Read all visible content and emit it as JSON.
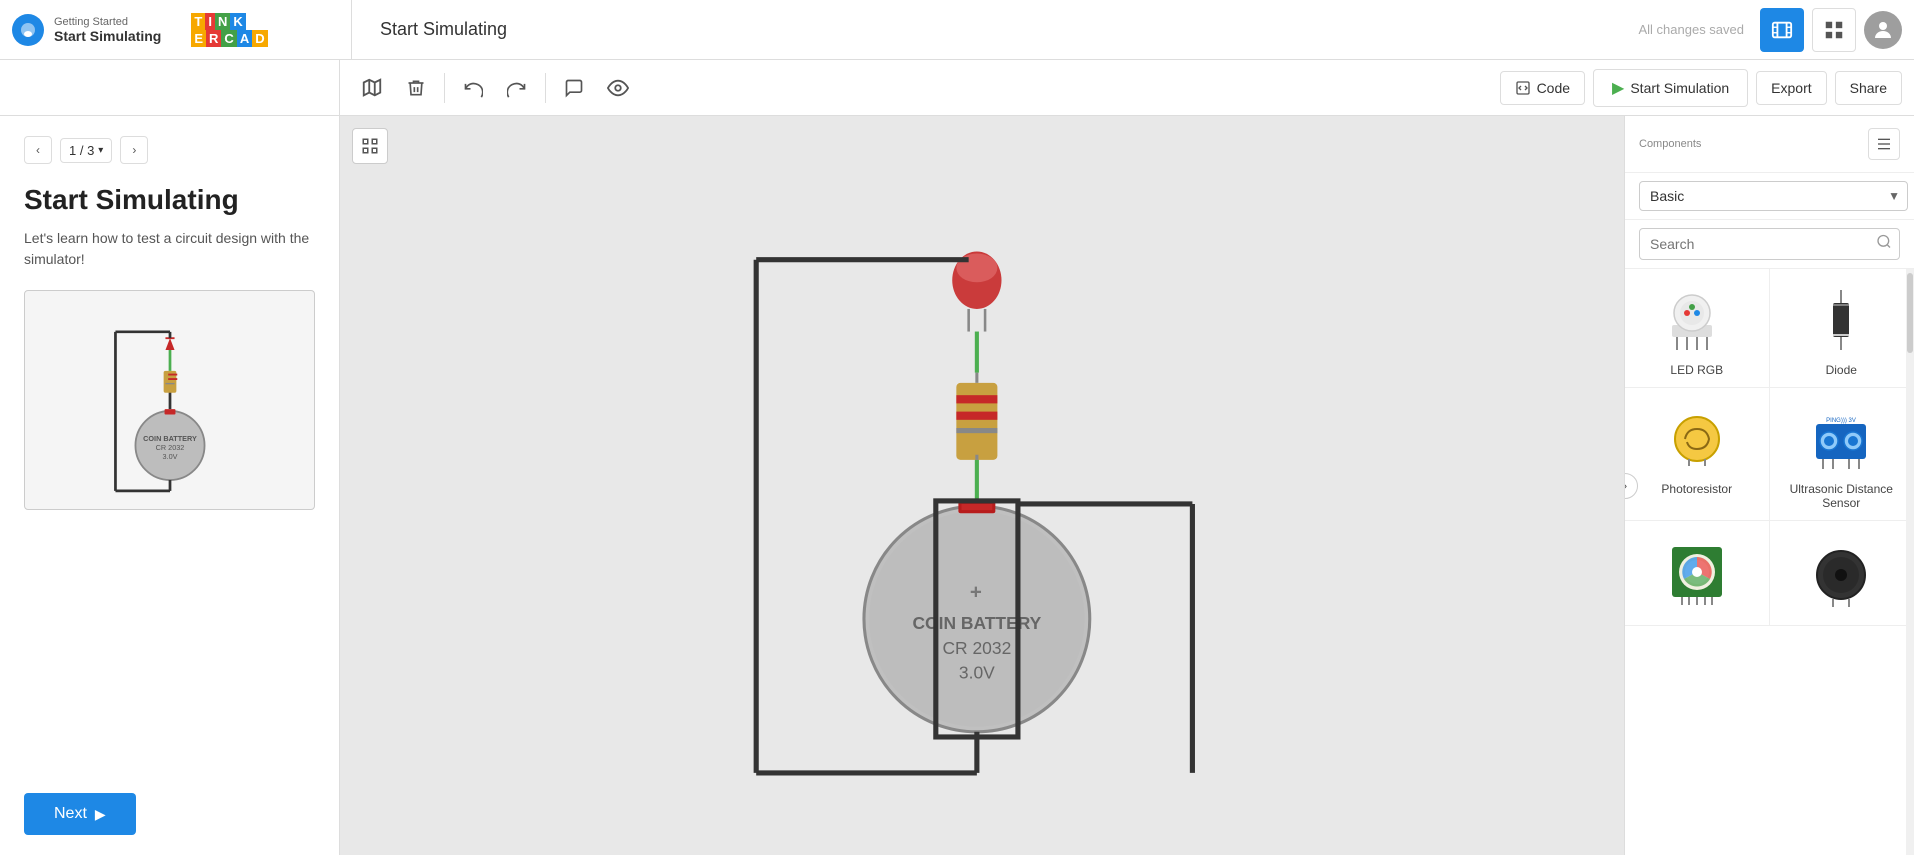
{
  "header": {
    "getting_started": "Getting Started",
    "start_simulating": "Start Simulating",
    "page_title": "Start Simulating",
    "all_saved": "All changes saved",
    "code_label": "Code",
    "start_sim_label": "Start Simulation",
    "export_label": "Export",
    "share_label": "Share"
  },
  "toolbar": {
    "snapshot_icon": "⬡",
    "delete_icon": "🗑",
    "undo_icon": "↩",
    "redo_icon": "↪",
    "comment_icon": "💬",
    "eye_icon": "👁"
  },
  "left_panel": {
    "page_prev": "‹",
    "page_label": "1 / 3",
    "page_dropdown": "▾",
    "page_next": "›",
    "step_title": "Start Simulating",
    "step_desc_part1": "Let's learn how to test a circuit design with the simulator!",
    "next_label": "Next"
  },
  "right_panel": {
    "components_label": "Components",
    "basic_option": "Basic",
    "search_placeholder": "Search",
    "items": [
      {
        "name": "LED RGB",
        "type": "led-rgb"
      },
      {
        "name": "Diode",
        "type": "diode"
      },
      {
        "name": "Photoresistor",
        "type": "photoresistor"
      },
      {
        "name": "Ultrasonic Distance Sensor",
        "type": "ultrasonic"
      },
      {
        "name": "",
        "type": "rgb-module"
      },
      {
        "name": "",
        "type": "buzzer"
      }
    ]
  }
}
